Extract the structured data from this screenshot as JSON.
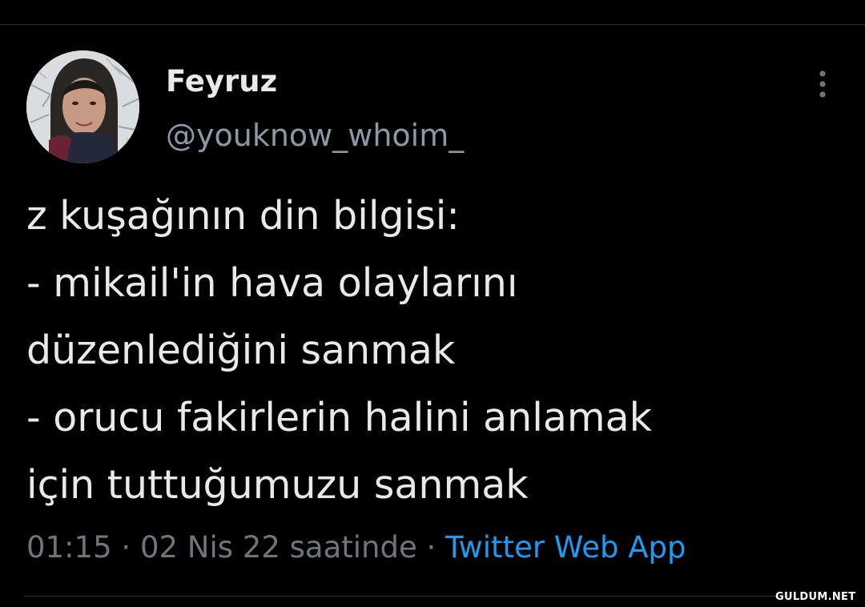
{
  "author": {
    "display_name": "Feyruz",
    "handle": "@youknow_whoim_"
  },
  "tweet": {
    "lines": [
      "z kuşağının din bilgisi:",
      "- mikail'in hava olaylarını",
      "düzenlediğini sanmak",
      "- orucu fakirlerin halini anlamak",
      "için tuttuğumuzu sanmak"
    ]
  },
  "meta": {
    "time": "01:15",
    "separator": " · ",
    "date": "02 Nis 22 saatinde",
    "source": "Twitter Web App"
  },
  "watermark": "GULDUM.NET",
  "icons": {
    "more": "more-vertical-icon",
    "avatar": "profile-photo"
  },
  "colors": {
    "background": "#000000",
    "text": "#e7e9ea",
    "muted": "#6e767d",
    "handle": "#8b98a5",
    "link": "#1d9bf0"
  }
}
